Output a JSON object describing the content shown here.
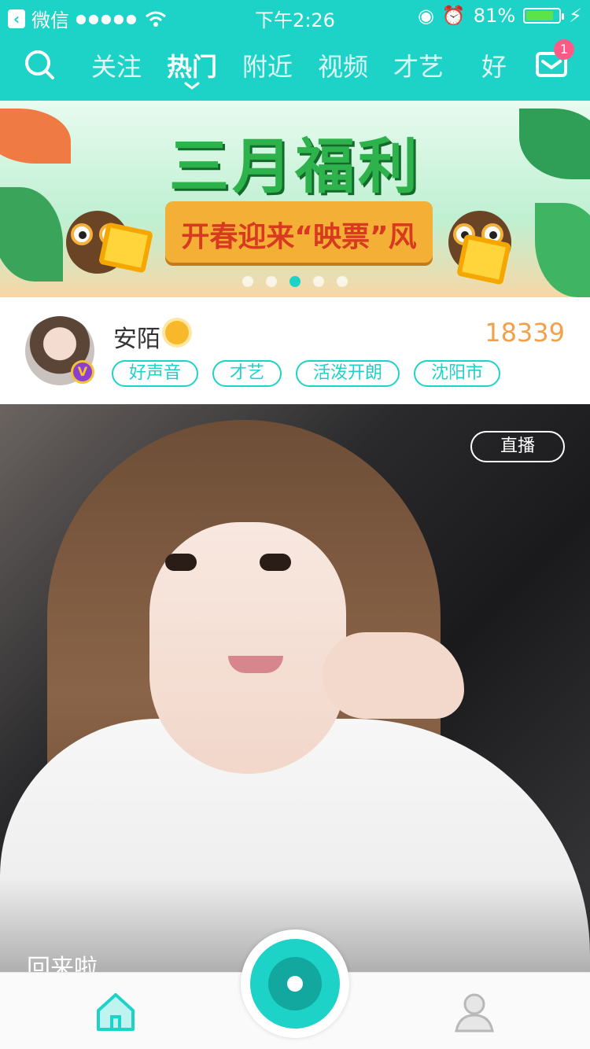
{
  "status_bar": {
    "back_app": "微信",
    "time": "下午2:26",
    "battery": "81%",
    "battery_level": 0.81
  },
  "nav": {
    "tabs": [
      "关注",
      "热门",
      "附近",
      "视频",
      "才艺",
      "好"
    ],
    "active_tab": "热门",
    "message_badge": "1",
    "icons": [
      "search-icon",
      "mail-icon"
    ]
  },
  "banner": {
    "title": "三月福利",
    "subtitle": "开春迎来“映票”风",
    "pages": 5,
    "active_page": 3
  },
  "profile": {
    "name": "安陌",
    "count": "18339",
    "tags": [
      "好声音",
      "才艺",
      "活泼开朗",
      "沈阳市"
    ],
    "badge": "V"
  },
  "feed": {
    "live_label": "直播",
    "caption": "回来啦"
  },
  "tabbar": {
    "icons": [
      "home-icon",
      "camera-record-icon",
      "person-icon"
    ]
  },
  "colors": {
    "accent": "#1dd3c7",
    "count": "#f2a04a",
    "badge": "#ff5a87"
  }
}
